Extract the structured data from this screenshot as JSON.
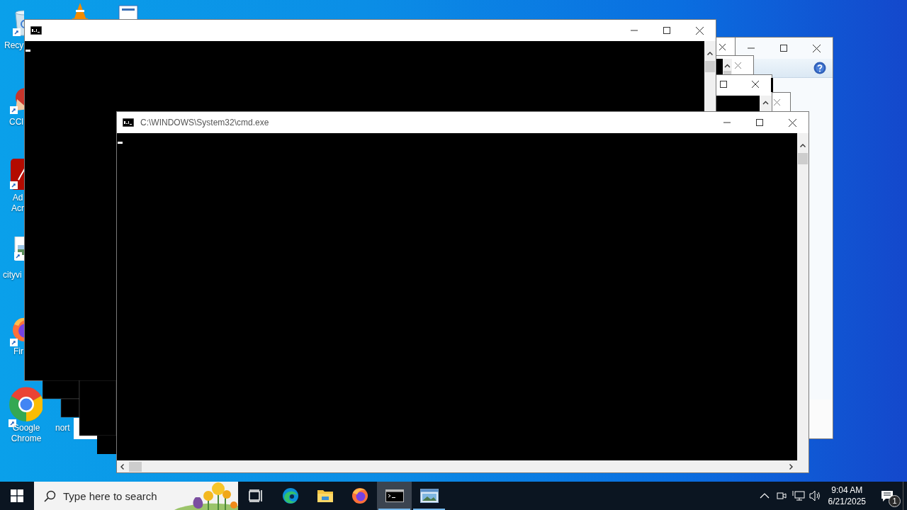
{
  "desktop_icons": [
    {
      "kind": "recycle-bin",
      "label": "Recy"
    },
    {
      "kind": "vlc"
    },
    {
      "kind": "document"
    },
    {
      "kind": "cleaner",
      "label": "CCl"
    },
    {
      "kind": "acrobat",
      "label": "Ad Acr"
    },
    {
      "kind": "image-file",
      "label": "cityvi"
    },
    {
      "kind": "firefox",
      "label": "Fir"
    },
    {
      "kind": "chrome",
      "label": "Google Chrome"
    },
    {
      "kind": "covered",
      "label": "nort"
    }
  ],
  "cmd_window": {
    "title": "C:\\WINDOWS\\System32\\cmd.exe"
  },
  "taskbar": {
    "search": {
      "placeholder": "Type here to search"
    },
    "apps": [
      {
        "kind": "task-view",
        "selected": false,
        "running": false
      },
      {
        "kind": "edge",
        "selected": false,
        "running": false
      },
      {
        "kind": "explorer",
        "selected": false,
        "running": false
      },
      {
        "kind": "firefox",
        "selected": false,
        "running": false
      },
      {
        "kind": "console",
        "selected": true,
        "running": true
      },
      {
        "kind": "photo-viewer",
        "selected": false,
        "running": true
      }
    ],
    "clock": {
      "time": "9:04 AM",
      "date": "6/21/2025"
    },
    "notifications": {
      "badge": "1"
    }
  }
}
